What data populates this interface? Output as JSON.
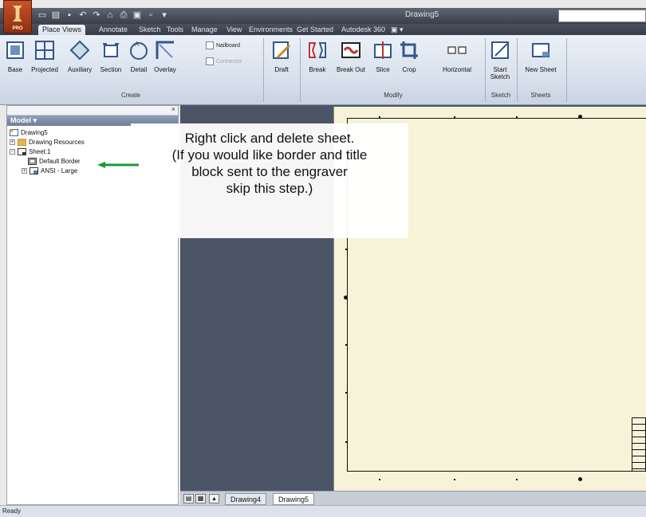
{
  "window": {
    "title": "Drawing5"
  },
  "ribbon_tabs": [
    "Place Views",
    "Annotate",
    "Sketch",
    "Tools",
    "Manage",
    "View",
    "Environments",
    "Get Started",
    "Autodesk 360"
  ],
  "ribbon": {
    "create_tools": [
      "Base",
      "Projected",
      "Auxiliary",
      "Section",
      "Detail",
      "Overlay"
    ],
    "small_tools": [
      "Nailboard",
      "Connector"
    ],
    "draft": "Draft",
    "modify_tools": [
      "Break",
      "Break Out",
      "Slice",
      "Crop"
    ],
    "horizontal": "Horizontal",
    "start_sketch": [
      "Start",
      "Sketch"
    ],
    "new_sheet": "New Sheet",
    "panels": {
      "create": "Create",
      "modify": "Modify",
      "sketch": "Sketch",
      "sheets": "Sheets"
    }
  },
  "browser": {
    "header": "Model",
    "tree": [
      "Drawing5",
      "Drawing Resources",
      "Sheet:1",
      "Default Border",
      "ANSI - Large"
    ]
  },
  "annotation": {
    "lines": [
      "Right click and delete sheet.",
      "(If you would like border and title",
      "block sent to the engraver",
      "skip this step.)"
    ]
  },
  "doc_tabs": [
    "Drawing4",
    "Drawing5"
  ],
  "status": "Ready",
  "colors": {
    "arrow": "#1a9a3c",
    "sheet": "#f6f3d8",
    "canvas": "#4c5566",
    "app_button": "#c9522a"
  }
}
